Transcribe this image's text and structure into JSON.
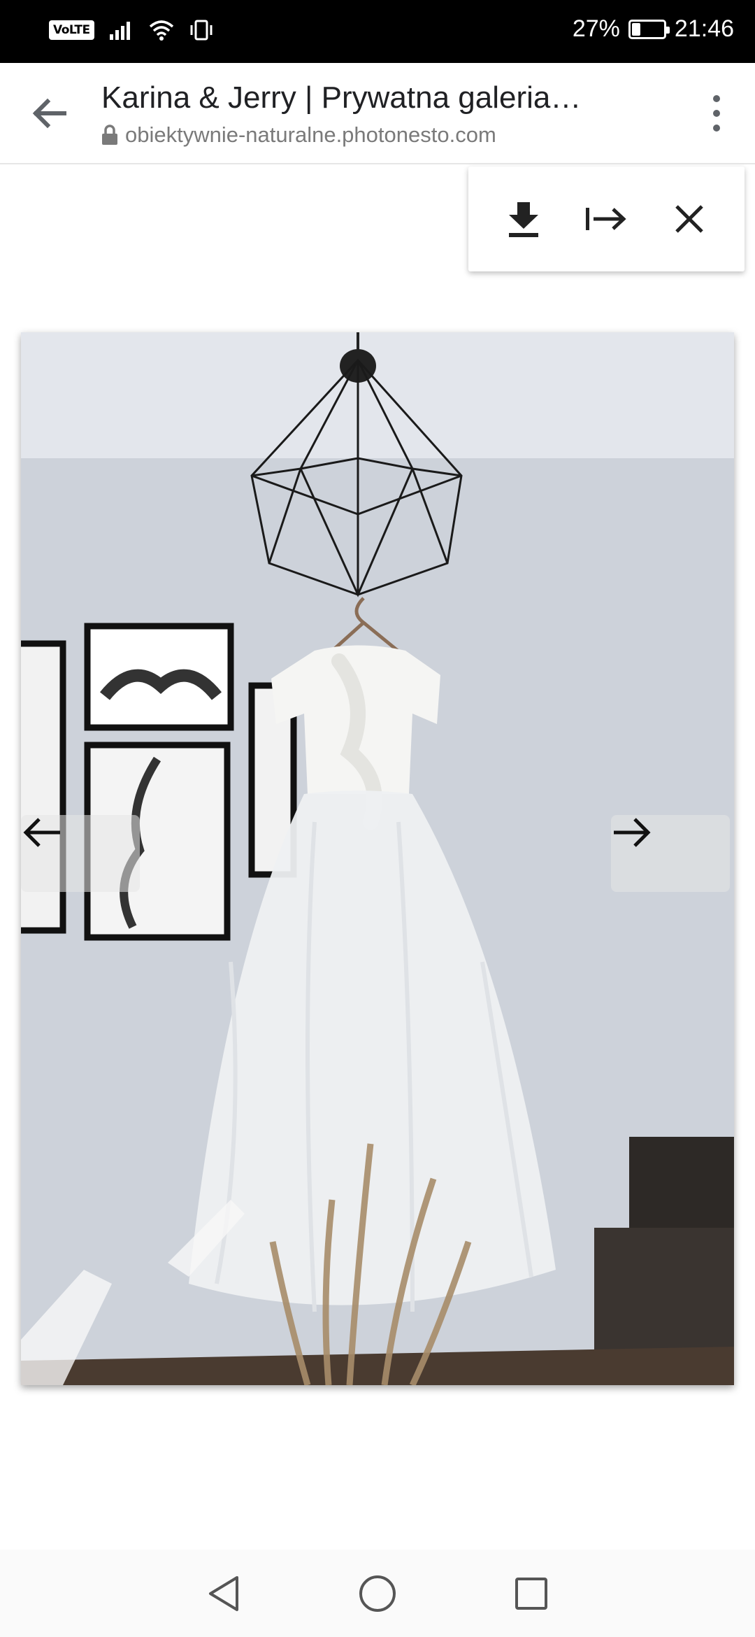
{
  "status_bar": {
    "network_badge": "VoLTE",
    "signal_icon": "signal-bars-icon",
    "wifi_icon": "wifi-icon",
    "vibrate_icon": "vibrate-icon",
    "battery_percent": "27%",
    "battery_level": 0.27,
    "time": "21:46"
  },
  "browser": {
    "back_icon": "arrow-back-icon",
    "title": "Karina & Jerry | Prywatna galeria…",
    "lock_icon": "lock-icon",
    "url": "obiektywnie-naturalne.photonesto.com",
    "menu_icon": "more-vert-icon"
  },
  "toolbar": {
    "download_icon": "download-icon",
    "next_step_icon": "arrow-right-to-bar-icon",
    "close_icon": "close-icon"
  },
  "gallery": {
    "photo_subject": "white dress on hanger under geometric wire pendant lamp",
    "prev_icon": "arrow-left-icon",
    "next_icon": "arrow-right-icon"
  },
  "system_nav": {
    "back_icon": "triangle-back-icon",
    "home_icon": "circle-home-icon",
    "recents_icon": "square-recents-icon"
  }
}
